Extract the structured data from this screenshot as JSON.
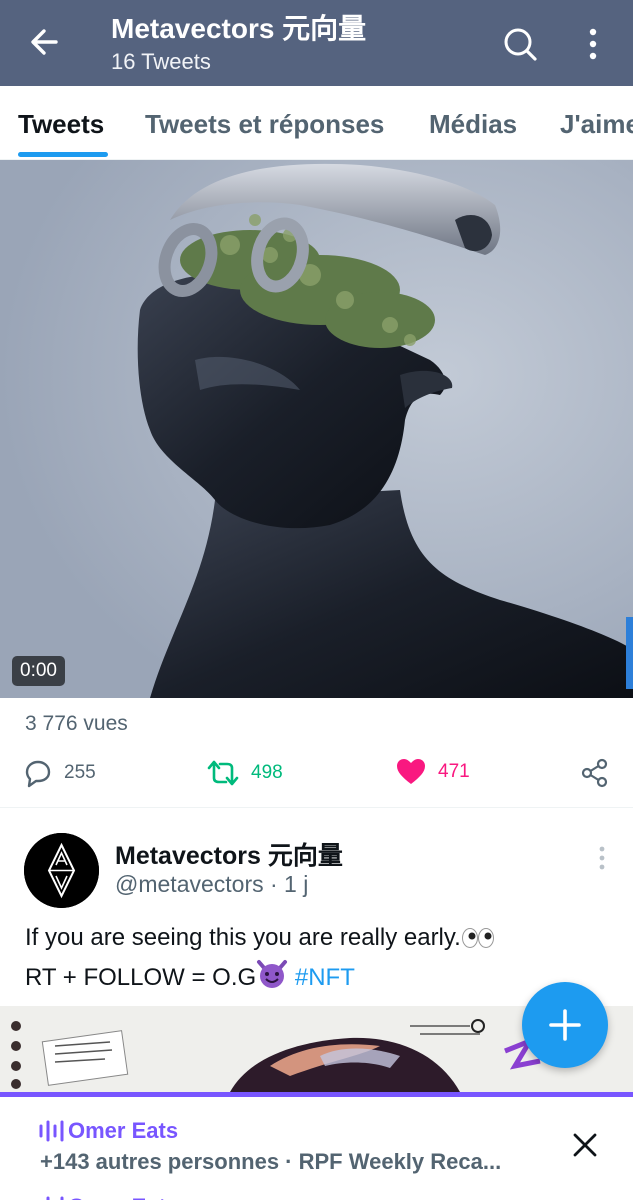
{
  "header": {
    "title": "Metavectors 元向量",
    "subtitle": "16 Tweets",
    "back_icon": "arrow-left-icon",
    "search_icon": "search-icon",
    "more_icon": "more-vertical-icon"
  },
  "tabs": [
    {
      "label": "Tweets",
      "active": true
    },
    {
      "label": "Tweets et réponses",
      "active": false
    },
    {
      "label": "Médias",
      "active": false
    },
    {
      "label": "J'aime",
      "active": false
    }
  ],
  "video": {
    "duration": "0:00",
    "views": "3 776 vues"
  },
  "actions": {
    "replies": "255",
    "retweets": "498",
    "likes": "471"
  },
  "tweet": {
    "name": "Metavectors 元向量",
    "handle": "@metavectors · 1 j",
    "line1": "If you are seeing this you are really early.",
    "line1_emoji": "eyes-emoji",
    "line2_prefix": "RT + FOLLOW = O.G",
    "line2_emoji": "smiling-devil-emoji",
    "hashtag": "#NFT"
  },
  "fab": {
    "icon": "plus-icon"
  },
  "space_bar": {
    "title": "Omer Eats",
    "subtitle": "+143 autres personnes · RPF Weekly Reca...",
    "icon": "audio-bars-icon",
    "close_icon": "close-icon"
  },
  "colors": {
    "header_bg": "#55637f",
    "accent": "#1d9bf0",
    "retweet": "#00ba7c",
    "like": "#f91880",
    "spaces": "#7856ff"
  }
}
